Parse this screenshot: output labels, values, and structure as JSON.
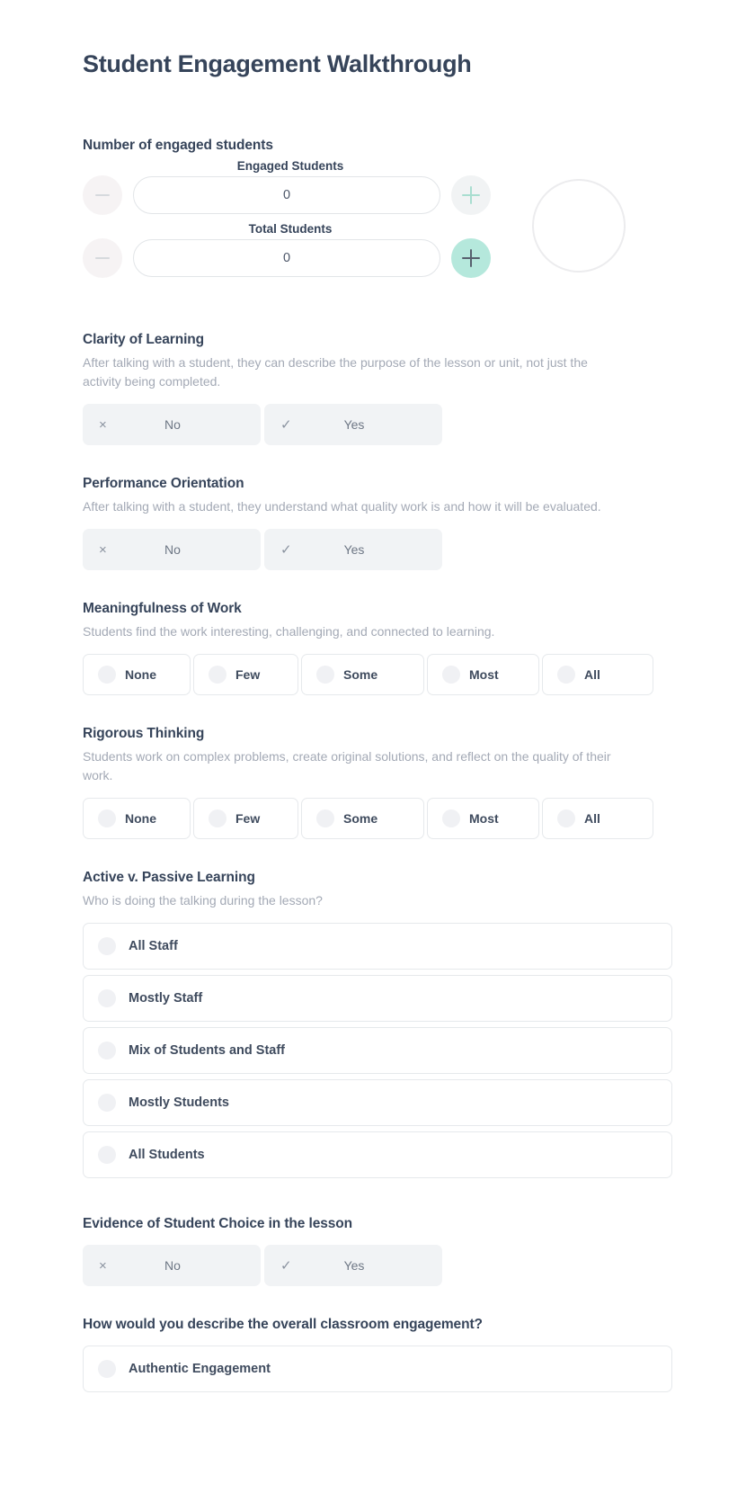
{
  "page": {
    "title": "Student Engagement Walkthrough"
  },
  "colors": {
    "heading": "#36445a",
    "muted_text": "#a3a9b5",
    "accent_mint": "#b5e8dc",
    "chip_bg": "#f1f3f5",
    "border": "#e6e9ec"
  },
  "counter_section": {
    "title": "Number of engaged students",
    "engaged": {
      "label": "Engaged Students",
      "value": "0",
      "minus_icon": "minus-icon",
      "plus_icon": "plus-icon"
    },
    "total": {
      "label": "Total Students",
      "value": "0",
      "minus_icon": "minus-icon",
      "plus_icon": "plus-icon"
    },
    "percent_circle": ""
  },
  "yes_no_labels": {
    "no": "No",
    "yes": "Yes",
    "no_icon": "×",
    "yes_icon": "✓"
  },
  "sections": [
    {
      "key": "clarity",
      "title": "Clarity of Learning",
      "description": "After talking with a student, they can describe the purpose of the lesson or unit, not just the activity being completed.",
      "type": "yes_no"
    },
    {
      "key": "performance",
      "title": "Performance Orientation",
      "description": "After talking with a student, they understand what quality work is and how it will be evaluated.",
      "type": "yes_no"
    },
    {
      "key": "meaningfulness",
      "title": "Meaningfulness of Work",
      "description": "Students find the work interesting, challenging, and connected to learning.",
      "type": "scale",
      "options": [
        "None",
        "Few",
        "Some",
        "Most",
        "All"
      ]
    },
    {
      "key": "rigorous",
      "title": "Rigorous Thinking",
      "description": "Students work on complex problems, create original solutions, and reflect on the quality of their work.",
      "type": "scale",
      "options": [
        "None",
        "Few",
        "Some",
        "Most",
        "All"
      ]
    },
    {
      "key": "active_passive",
      "title": "Active v. Passive Learning",
      "description": "Who is doing the talking during the lesson?",
      "type": "stack",
      "options": [
        "All Staff",
        "Mostly Staff",
        "Mix of Students and Staff",
        "Mostly Students",
        "All Students"
      ]
    },
    {
      "key": "student_choice",
      "title": "Evidence of Student Choice in the lesson",
      "description": "",
      "type": "yes_no"
    },
    {
      "key": "overall",
      "title": "How would you describe the overall classroom engagement?",
      "description": "",
      "type": "stack",
      "options": [
        "Authentic Engagement"
      ]
    }
  ]
}
